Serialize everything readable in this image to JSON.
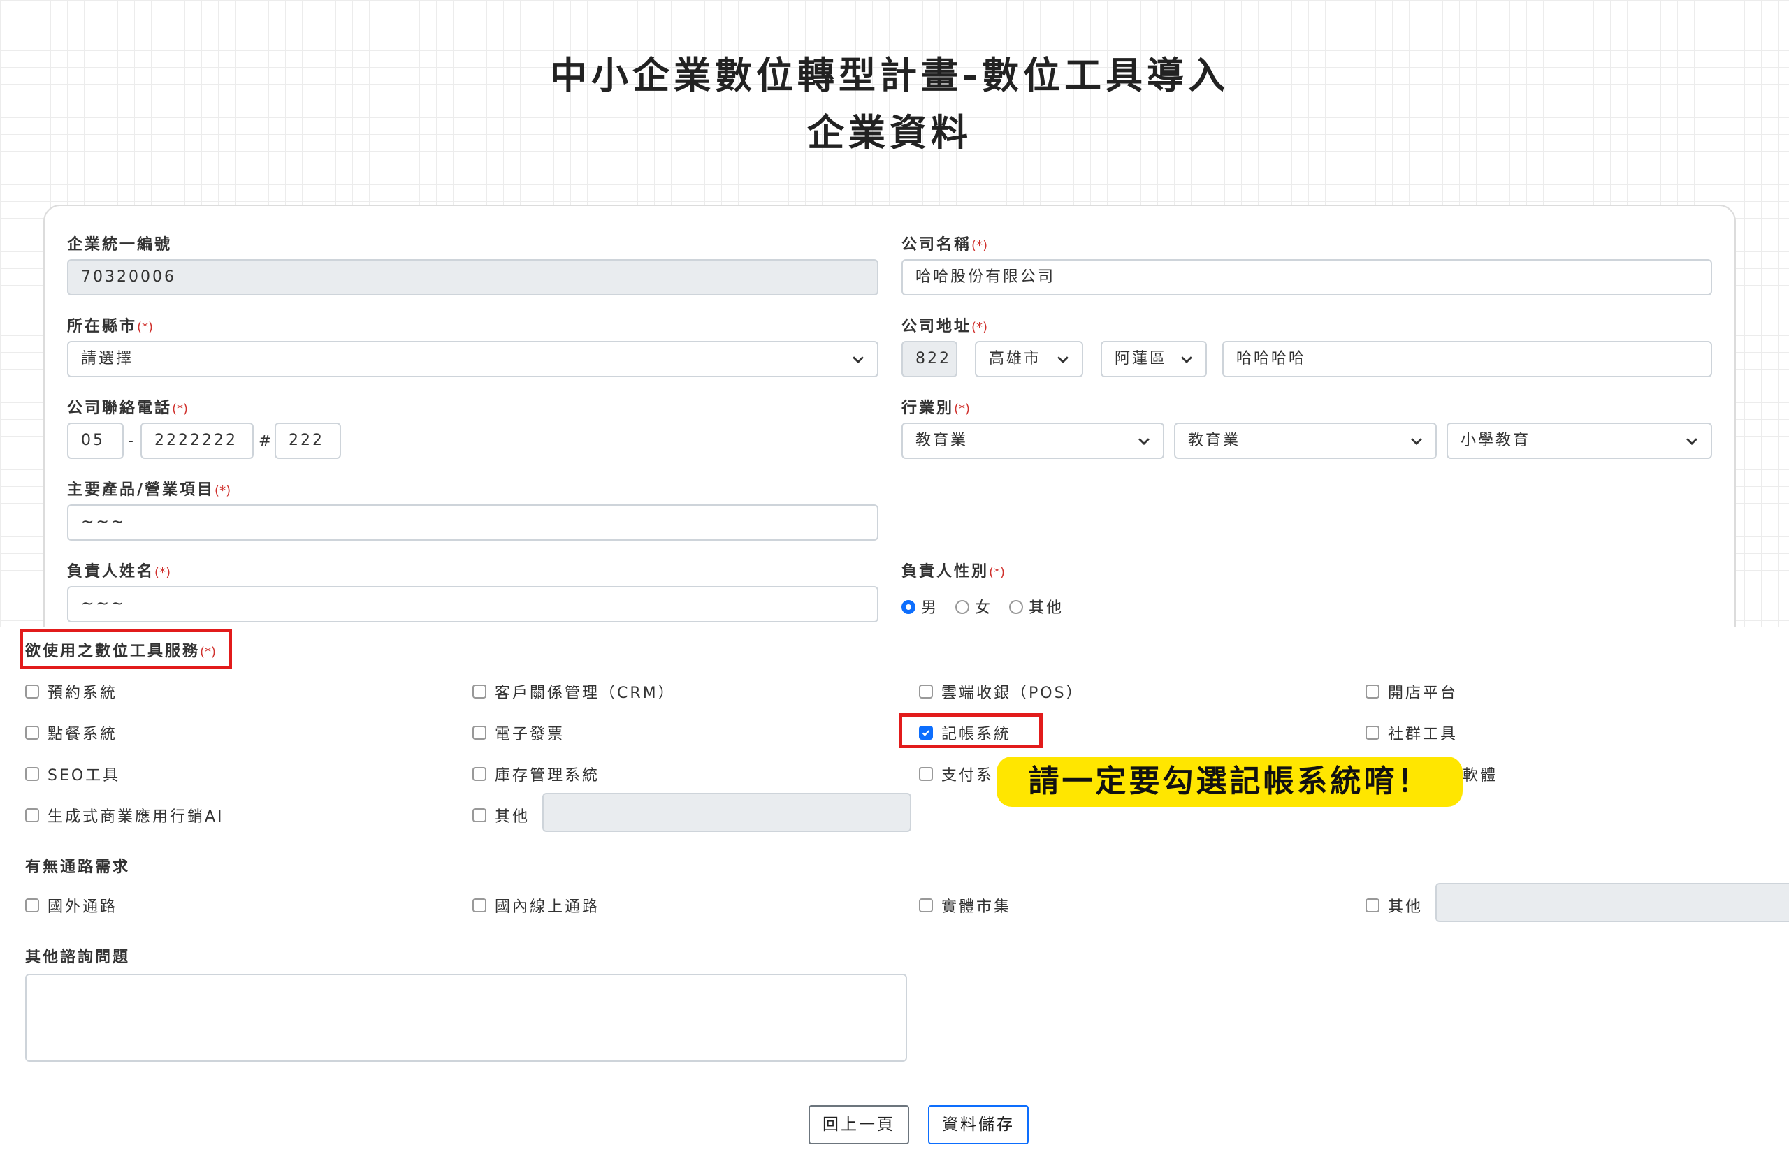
{
  "header": {
    "title_line1": "中小企業數位轉型計畫-數位工具導入",
    "title_line2": "企業資料"
  },
  "form": {
    "required_mark": "(*)",
    "tax_id": {
      "label": "企業統一編號",
      "value": "70320006"
    },
    "company_name": {
      "label": "公司名稱",
      "value": "哈哈股份有限公司"
    },
    "city": {
      "label": "所在縣市",
      "value": "請選擇"
    },
    "address": {
      "label": "公司地址",
      "zip": "822",
      "city": "高雄市",
      "district": "阿蓮區",
      "street": "哈哈哈哈"
    },
    "phone": {
      "label": "公司聯絡電話",
      "area": "05",
      "dash": "-",
      "number": "2222222",
      "hash": "#",
      "ext": "222"
    },
    "industry": {
      "label": "行業別",
      "level1": "教育業",
      "level2": "教育業",
      "level3": "小學教育"
    },
    "products": {
      "label": "主要產品/營業項目",
      "value": "~~~"
    },
    "owner_name": {
      "label": "負責人姓名",
      "value": "~~~"
    },
    "owner_gender": {
      "label": "負責人性別",
      "options": [
        "男",
        "女",
        "其他"
      ],
      "selected": "男"
    },
    "digital_tools": {
      "label": "欲使用之數位工具服務",
      "options": [
        {
          "label": "預約系統",
          "checked": false
        },
        {
          "label": "客戶關係管理（CRM）",
          "checked": false
        },
        {
          "label": "雲端收銀（POS）",
          "checked": false
        },
        {
          "label": "開店平台",
          "checked": false
        },
        {
          "label": "點餐系統",
          "checked": false
        },
        {
          "label": "電子發票",
          "checked": false
        },
        {
          "label": "記帳系統",
          "checked": true
        },
        {
          "label": "社群工具",
          "checked": false
        },
        {
          "label": "SEO工具",
          "checked": false
        },
        {
          "label": "庫存管理系統",
          "checked": false
        },
        {
          "label": "支付系",
          "checked": false
        },
        {
          "label": "軟體",
          "checked": false
        },
        {
          "label": "生成式商業應用行銷AI",
          "checked": false
        },
        {
          "label": "其他",
          "checked": false
        }
      ]
    },
    "channels": {
      "label": "有無通路需求",
      "options": [
        {
          "label": "國外通路",
          "checked": false
        },
        {
          "label": "國內線上通路",
          "checked": false
        },
        {
          "label": "實體市集",
          "checked": false
        },
        {
          "label": "其他",
          "checked": false
        }
      ]
    },
    "other_questions": {
      "label": "其他諮詢問題",
      "value": ""
    }
  },
  "buttons": {
    "back": "回上一頁",
    "save": "資料儲存"
  },
  "annotation": {
    "callout_text": "請一定要勾選記帳系統唷！",
    "highlight_color": "#e21b1b",
    "callout_color": "#ffe600"
  },
  "colors": {
    "accent": "#0d6efd",
    "required": "#d0312d"
  }
}
